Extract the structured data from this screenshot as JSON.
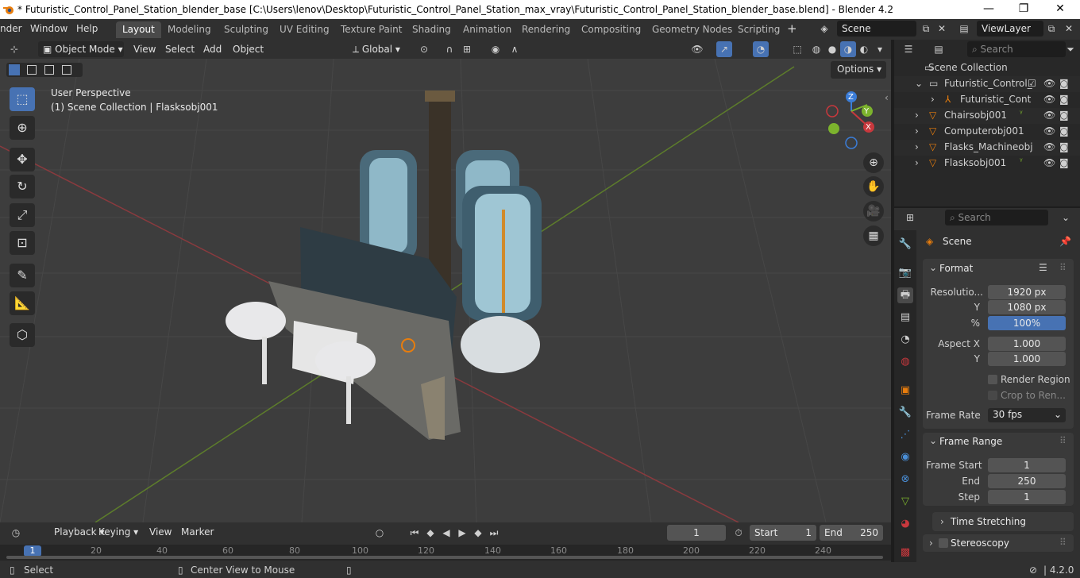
{
  "titlebar": {
    "title": "* Futuristic_Control_Panel_Station_blender_base [C:\\Users\\lenov\\Desktop\\Futuristic_Control_Panel_Station_max_vray\\Futuristic_Control_Panel_Station_blender_base.blend] - Blender 4.2",
    "minimize": "—",
    "maximize": "❐",
    "close": "✕"
  },
  "topbar": {
    "menus": [
      "nder",
      "Window",
      "Help"
    ],
    "workspaces": [
      "Layout",
      "Modeling",
      "Sculpting",
      "UV Editing",
      "Texture Paint",
      "Shading",
      "Animation",
      "Rendering",
      "Compositing",
      "Geometry Nodes",
      "Scripting"
    ],
    "add_tab": "+",
    "scene": "Scene",
    "view_layer": "ViewLayer"
  },
  "viewport_header": {
    "mode": "Object Mode",
    "menus": [
      "View",
      "Select",
      "Add",
      "Object"
    ],
    "transform_orientation": "Global",
    "options": "Options"
  },
  "viewport": {
    "perspective": "User Perspective",
    "collection_info": "(1) Scene Collection | Flasksobj001",
    "gizmo_axes": [
      "Z",
      "Y",
      "X"
    ]
  },
  "outliner": {
    "search_placeholder": "Search",
    "root": "Scene Collection",
    "items": [
      {
        "label": "Futuristic_Control_"
      },
      {
        "label": "Futuristic_Cont"
      },
      {
        "label": "Chairsobj001"
      },
      {
        "label": "Computerobj001"
      },
      {
        "label": "Flasks_Machineobj"
      },
      {
        "label": "Flasksobj001"
      }
    ]
  },
  "properties": {
    "search_placeholder": "Search",
    "context": "Scene",
    "format_panel": {
      "title": "Format",
      "resolution_label": "Resolutio...",
      "resolution_x": "1920 px",
      "y_label": "Y",
      "resolution_y": "1080 px",
      "percent_label": "%",
      "percent": "100%",
      "aspect_x_label": "Aspect X",
      "aspect_x": "1.000",
      "aspect_y_label": "Y",
      "aspect_y": "1.000",
      "render_region": "Render Region",
      "crop": "Crop to Ren...",
      "frame_rate_label": "Frame Rate",
      "frame_rate": "30 fps"
    },
    "frame_range_panel": {
      "title": "Frame Range",
      "start_label": "Frame Start",
      "start": "1",
      "end_label": "End",
      "end": "250",
      "step_label": "Step",
      "step": "1"
    },
    "time_stretching": "Time Stretching",
    "stereoscopy": "Stereoscopy"
  },
  "timeline": {
    "menus": [
      "Playback",
      "Keying",
      "View",
      "Marker"
    ],
    "current_frame": "1",
    "start_label": "Start",
    "start": "1",
    "end_label": "End",
    "end": "250",
    "ticks": [
      "1",
      "20",
      "40",
      "60",
      "80",
      "100",
      "120",
      "140",
      "160",
      "180",
      "200",
      "220",
      "240"
    ]
  },
  "statusbar": {
    "select": "Select",
    "center_view": "Center View to Mouse",
    "version": "4.2.0"
  },
  "colors": {
    "accent": "#4772b3",
    "x_axis": "#c8383d",
    "y_axis": "#7cb32d",
    "z_axis": "#3b7dd8"
  }
}
